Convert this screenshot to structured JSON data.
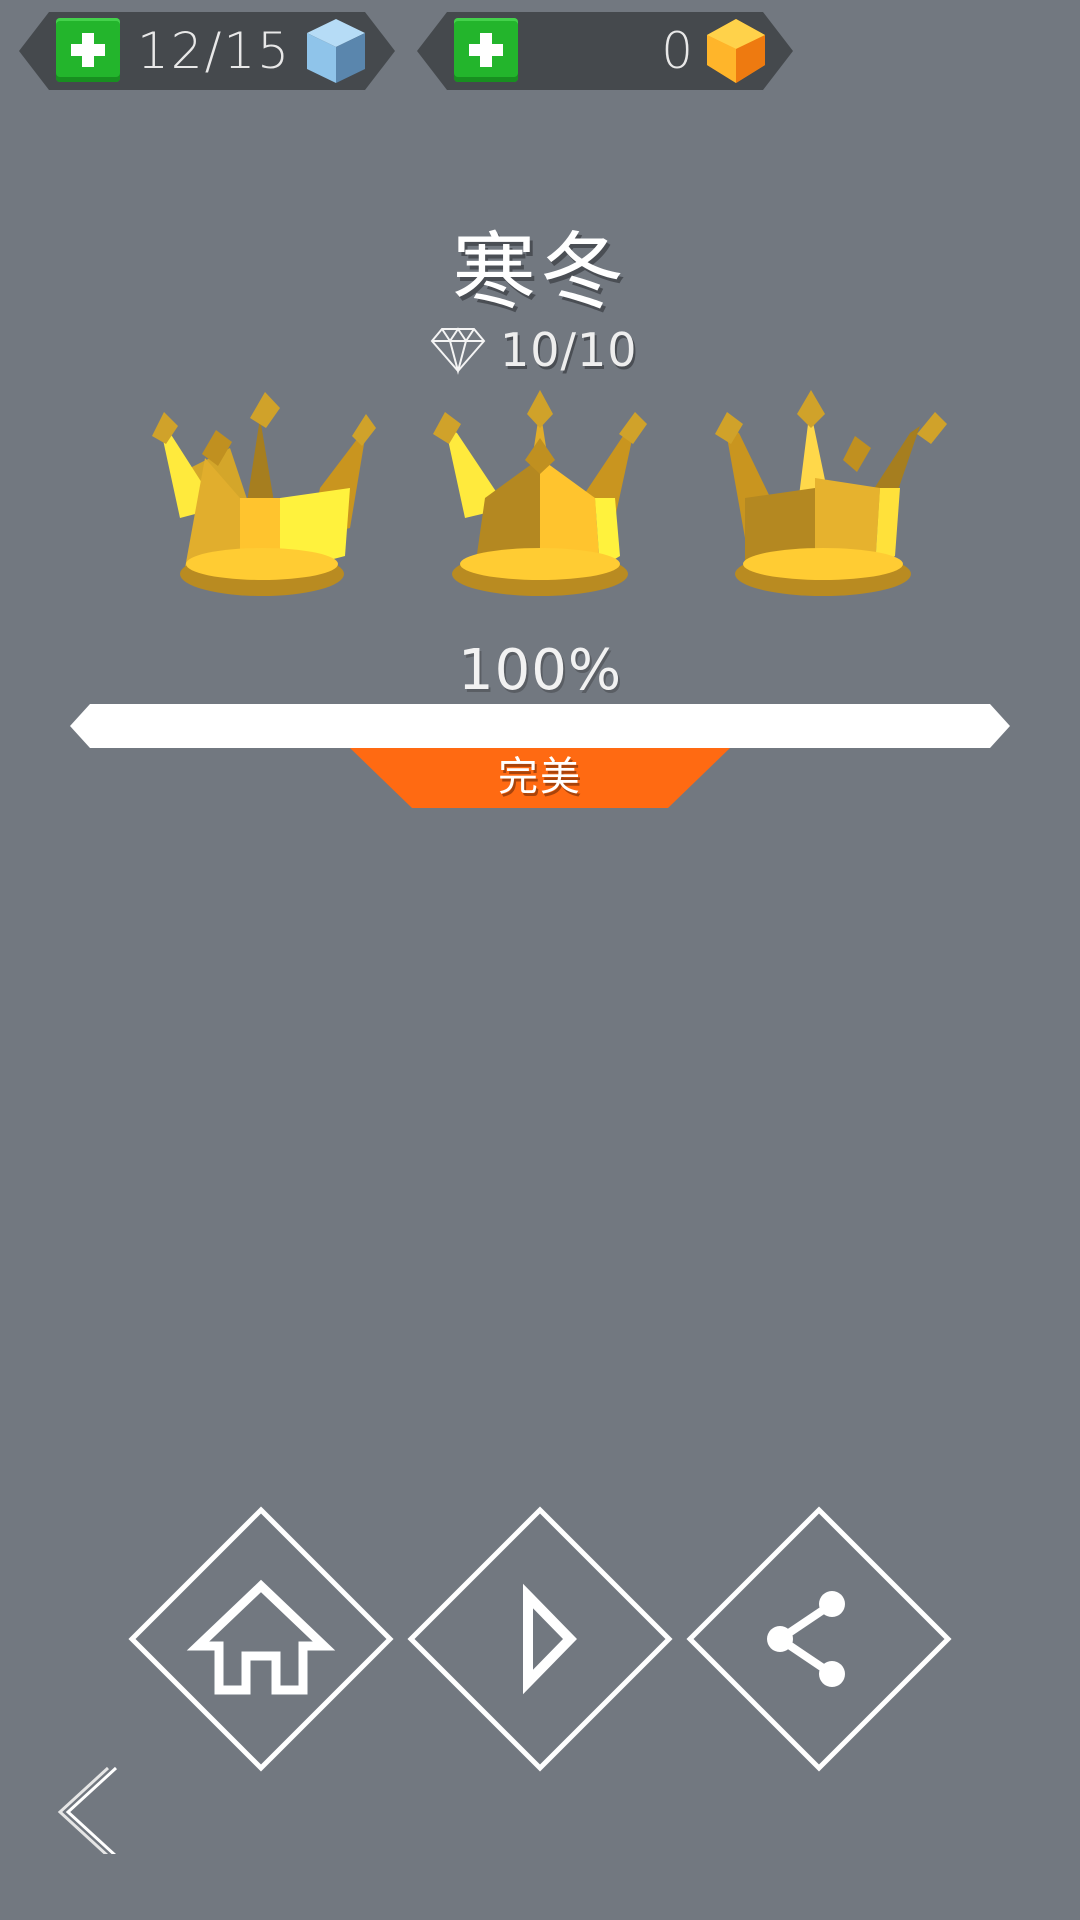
{
  "resources": {
    "lives": {
      "count": "12/15",
      "icon": "blue-cube-icon",
      "color": "#8fc4ea"
    },
    "gems": {
      "count": "0",
      "icon": "orange-gem-icon",
      "color": "#ffb52a"
    }
  },
  "level": {
    "title": "寒冬",
    "score": "10/10",
    "score_icon": "diamond-icon"
  },
  "crowns": {
    "earned": 3,
    "total": 3,
    "color": "#e2b22c"
  },
  "progress": {
    "percent_label": "100%",
    "fraction": 1.0,
    "rating": "完美",
    "rating_color": "#ff6a12"
  },
  "actions": {
    "home_icon": "home-icon",
    "play_icon": "play-icon",
    "share_icon": "share-icon",
    "back_icon": "back-chevron-icon"
  }
}
